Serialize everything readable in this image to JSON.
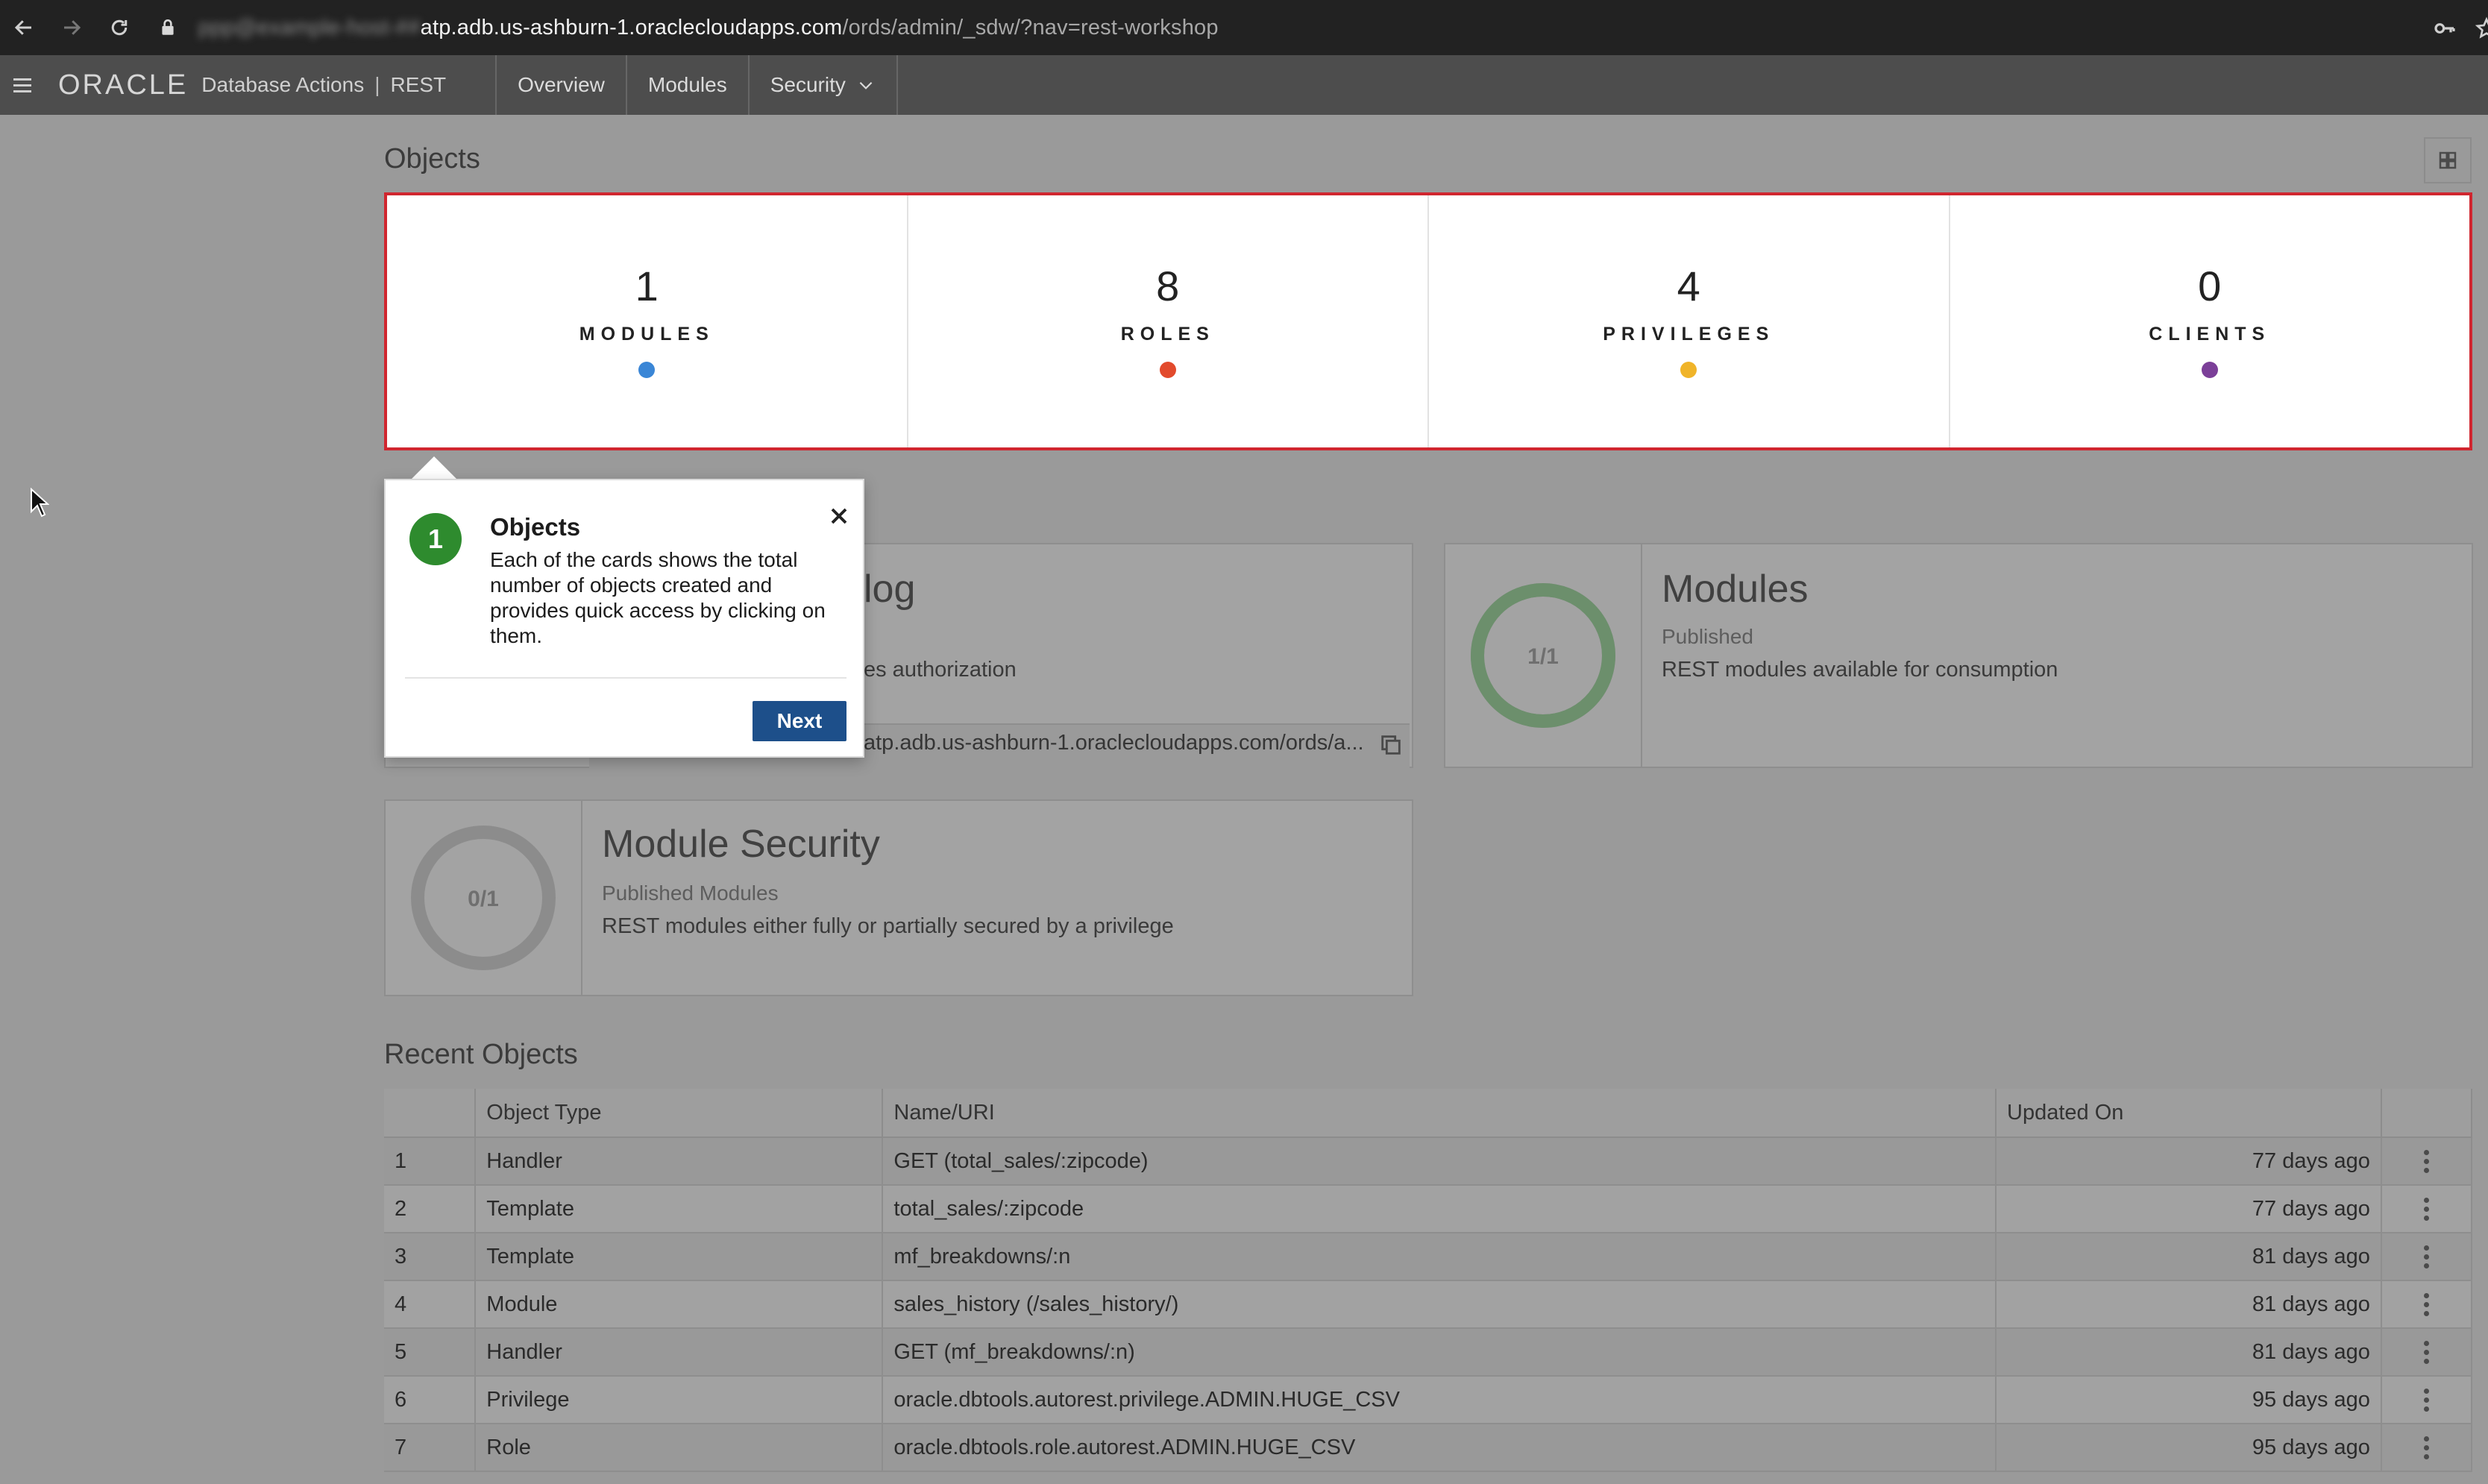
{
  "browser": {
    "url_blurred": "ppp@example-host-##",
    "url_host": "atp.adb.us-ashburn-1.oraclecloudapps.com",
    "url_path": "/ords/admin/_sdw/?nav=rest-workshop"
  },
  "header": {
    "logo": "ORACLE",
    "product": "Database Actions",
    "section": "REST",
    "tabs": [
      {
        "label": "Overview"
      },
      {
        "label": "Modules"
      },
      {
        "label": "Security"
      }
    ]
  },
  "objects": {
    "title": "Objects",
    "cards": [
      {
        "count": "1",
        "label": "MODULES",
        "color": "#3a86d6"
      },
      {
        "count": "8",
        "label": "ROLES",
        "color": "#e24a2c"
      },
      {
        "count": "4",
        "label": "PRIVILEGES",
        "color": "#f0b429"
      },
      {
        "count": "0",
        "label": "CLIENTS",
        "color": "#7b3f98"
      }
    ]
  },
  "panels": {
    "catalog": {
      "title_partial": "log",
      "desc_partial": "es authorization",
      "url_partial": "atp.adb.us-ashburn-1.oraclecloudapps.com/ords/a..."
    },
    "modules": {
      "ring_label": "1/1",
      "ring_fraction": 1,
      "title": "Modules",
      "subtitle": "Published",
      "description": "REST modules available for consumption"
    },
    "module_security": {
      "ring_label": "0/1",
      "ring_fraction": 0,
      "title": "Module Security",
      "subtitle": "Published Modules",
      "description": "REST modules either fully or partially secured by a privilege"
    }
  },
  "recent": {
    "title": "Recent Objects",
    "columns": [
      "",
      "Object Type",
      "Name/URI",
      "Updated On",
      ""
    ],
    "rows": [
      {
        "n": "1",
        "type": "Handler",
        "name": "GET (total_sales/:zipcode)",
        "updated": "77 days ago"
      },
      {
        "n": "2",
        "type": "Template",
        "name": "total_sales/:zipcode",
        "updated": "77 days ago"
      },
      {
        "n": "3",
        "type": "Template",
        "name": "mf_breakdowns/:n",
        "updated": "81 days ago"
      },
      {
        "n": "4",
        "type": "Module",
        "name": "sales_history (/sales_history/)",
        "updated": "81 days ago"
      },
      {
        "n": "5",
        "type": "Handler",
        "name": "GET (mf_breakdowns/:n)",
        "updated": "81 days ago"
      },
      {
        "n": "6",
        "type": "Privilege",
        "name": "oracle.dbtools.autorest.privilege.ADMIN.HUGE_CSV",
        "updated": "95 days ago"
      },
      {
        "n": "7",
        "type": "Role",
        "name": "oracle.dbtools.role.autorest.ADMIN.HUGE_CSV",
        "updated": "95 days ago"
      }
    ]
  },
  "tour": {
    "step": "1",
    "title": "Objects",
    "body": "Each of the cards shows the total number of objects created and provides quick access by clicking on them.",
    "next_label": "Next"
  }
}
